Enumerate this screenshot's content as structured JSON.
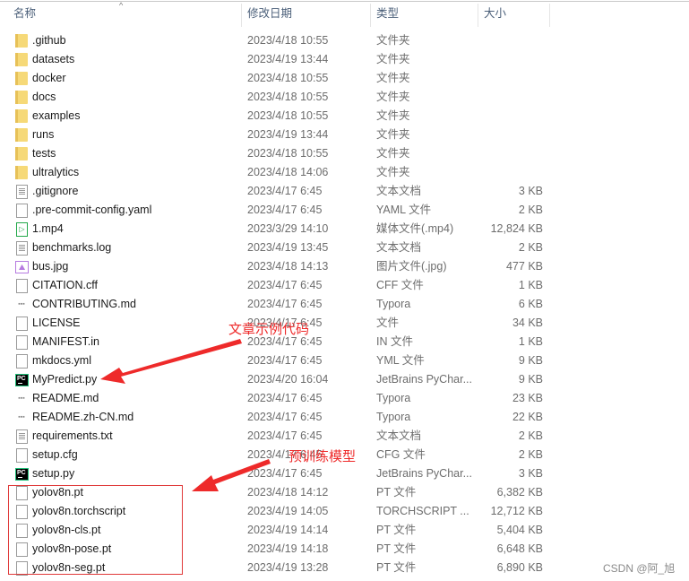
{
  "header": {
    "columns": [
      {
        "key": "name",
        "label": "名称"
      },
      {
        "key": "date",
        "label": "修改日期"
      },
      {
        "key": "type",
        "label": "类型"
      },
      {
        "key": "size",
        "label": "大小"
      }
    ],
    "sort_indicator": "^"
  },
  "files": [
    {
      "name": ".github",
      "date": "2023/4/18 10:55",
      "type": "文件夹",
      "size": "",
      "icon": "folder-icon"
    },
    {
      "name": "datasets",
      "date": "2023/4/19 13:44",
      "type": "文件夹",
      "size": "",
      "icon": "folder-icon"
    },
    {
      "name": "docker",
      "date": "2023/4/18 10:55",
      "type": "文件夹",
      "size": "",
      "icon": "folder-icon"
    },
    {
      "name": "docs",
      "date": "2023/4/18 10:55",
      "type": "文件夹",
      "size": "",
      "icon": "folder-icon"
    },
    {
      "name": "examples",
      "date": "2023/4/18 10:55",
      "type": "文件夹",
      "size": "",
      "icon": "folder-icon"
    },
    {
      "name": "runs",
      "date": "2023/4/19 13:44",
      "type": "文件夹",
      "size": "",
      "icon": "folder-icon"
    },
    {
      "name": "tests",
      "date": "2023/4/18 10:55",
      "type": "文件夹",
      "size": "",
      "icon": "folder-icon"
    },
    {
      "name": "ultralytics",
      "date": "2023/4/18 14:06",
      "type": "文件夹",
      "size": "",
      "icon": "folder-icon"
    },
    {
      "name": ".gitignore",
      "date": "2023/4/17 6:45",
      "type": "文本文档",
      "size": "3 KB",
      "icon": "text-file-icon"
    },
    {
      "name": ".pre-commit-config.yaml",
      "date": "2023/4/17 6:45",
      "type": "YAML 文件",
      "size": "2 KB",
      "icon": "blank-file-icon"
    },
    {
      "name": "1.mp4",
      "date": "2023/3/29 14:10",
      "type": "媒体文件(.mp4)",
      "size": "12,824 KB",
      "icon": "media-file-icon"
    },
    {
      "name": "benchmarks.log",
      "date": "2023/4/19 13:45",
      "type": "文本文档",
      "size": "2 KB",
      "icon": "text-file-icon"
    },
    {
      "name": "bus.jpg",
      "date": "2023/4/18 14:13",
      "type": "图片文件(.jpg)",
      "size": "477 KB",
      "icon": "image-file-icon"
    },
    {
      "name": "CITATION.cff",
      "date": "2023/4/17 6:45",
      "type": "CFF 文件",
      "size": "1 KB",
      "icon": "blank-file-icon"
    },
    {
      "name": "CONTRIBUTING.md",
      "date": "2023/4/17 6:45",
      "type": "Typora",
      "size": "6 KB",
      "icon": "typora-file-icon"
    },
    {
      "name": "LICENSE",
      "date": "2023/4/17 6:45",
      "type": "文件",
      "size": "34 KB",
      "icon": "blank-file-icon"
    },
    {
      "name": "MANIFEST.in",
      "date": "2023/4/17 6:45",
      "type": "IN 文件",
      "size": "1 KB",
      "icon": "blank-file-icon"
    },
    {
      "name": "mkdocs.yml",
      "date": "2023/4/17 6:45",
      "type": "YML 文件",
      "size": "9 KB",
      "icon": "blank-file-icon"
    },
    {
      "name": "MyPredict.py",
      "date": "2023/4/20 16:04",
      "type": "JetBrains PyChar...",
      "size": "9 KB",
      "icon": "pycharm-file-icon"
    },
    {
      "name": "README.md",
      "date": "2023/4/17 6:45",
      "type": "Typora",
      "size": "23 KB",
      "icon": "typora-file-icon"
    },
    {
      "name": "README.zh-CN.md",
      "date": "2023/4/17 6:45",
      "type": "Typora",
      "size": "22 KB",
      "icon": "typora-file-icon"
    },
    {
      "name": "requirements.txt",
      "date": "2023/4/17 6:45",
      "type": "文本文档",
      "size": "2 KB",
      "icon": "text-file-icon"
    },
    {
      "name": "setup.cfg",
      "date": "2023/4/17 6:45",
      "type": "CFG 文件",
      "size": "2 KB",
      "icon": "blank-file-icon"
    },
    {
      "name": "setup.py",
      "date": "2023/4/17 6:45",
      "type": "JetBrains PyChar...",
      "size": "3 KB",
      "icon": "pycharm-file-icon"
    },
    {
      "name": "yolov8n.pt",
      "date": "2023/4/18 14:12",
      "type": "PT 文件",
      "size": "6,382 KB",
      "icon": "blank-file-icon"
    },
    {
      "name": "yolov8n.torchscript",
      "date": "2023/4/19 14:05",
      "type": "TORCHSCRIPT ...",
      "size": "12,712 KB",
      "icon": "blank-file-icon"
    },
    {
      "name": "yolov8n-cls.pt",
      "date": "2023/4/19 14:14",
      "type": "PT 文件",
      "size": "5,404 KB",
      "icon": "blank-file-icon"
    },
    {
      "name": "yolov8n-pose.pt",
      "date": "2023/4/19 14:18",
      "type": "PT 文件",
      "size": "6,648 KB",
      "icon": "blank-file-icon"
    },
    {
      "name": "yolov8n-seg.pt",
      "date": "2023/4/19 13:28",
      "type": "PT 文件",
      "size": "6,890 KB",
      "icon": "blank-file-icon"
    }
  ],
  "annotations": {
    "example_code": "文章示例代码",
    "pretrained_models": "预训练模型",
    "color": "#ee2a2a"
  },
  "watermark": "CSDN @阿_旭"
}
